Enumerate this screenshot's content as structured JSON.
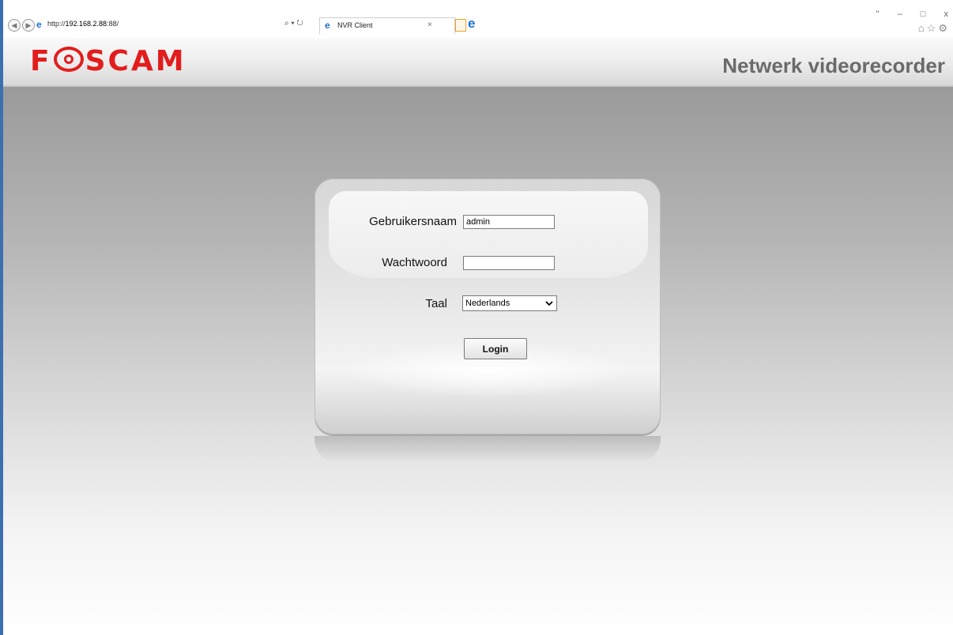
{
  "browser": {
    "address_prefix": "http://",
    "address_host": "192.168.2.88",
    "address_suffix": ":88/",
    "tab_title": "NVR Client",
    "search_glyph": "⌕ ▾ ↻",
    "tab_close": "×",
    "window_controls": [
      "\"",
      "–",
      "□",
      "x"
    ]
  },
  "header": {
    "logo_text": "FOSCAM",
    "title": "Netwerk videorecorder"
  },
  "login": {
    "username_label": "Gebruikersnaam",
    "username_value": "admin",
    "password_label": "Wachtwoord",
    "password_value": "",
    "language_label": "Taal",
    "language_value": "Nederlands",
    "login_label": "Login"
  },
  "colors": {
    "brand": "#e21d1d",
    "title_gray": "#6a6a6a",
    "window_edge": "#3c6fb0"
  }
}
